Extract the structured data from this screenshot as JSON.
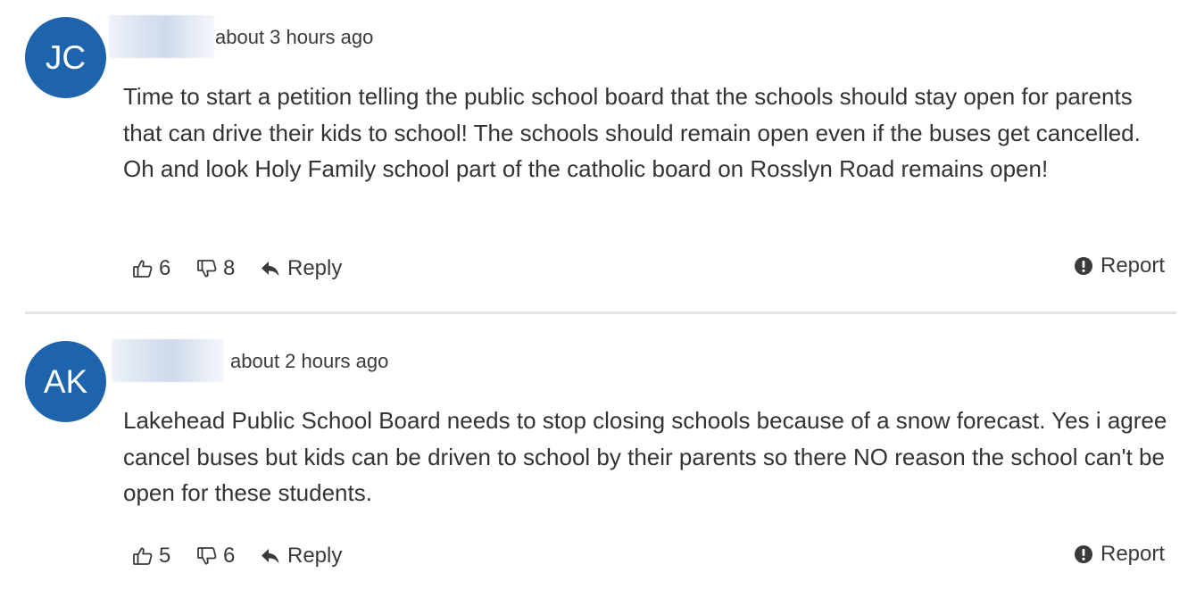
{
  "comments": [
    {
      "initials": "JC",
      "timestamp": "about 3 hours ago",
      "text": "Time to start a petition telling the public school board that the schools should stay open for parents that can drive their kids to school! The schools should remain open even if the buses get cancelled. Oh and look Holy Family school part of the catholic board on Rosslyn Road remains open!",
      "likes": "6",
      "dislikes": "8",
      "reply_label": "Reply",
      "report_label": "Report"
    },
    {
      "initials": "AK",
      "timestamp": "about 2 hours ago",
      "text": "Lakehead Public School Board needs to stop closing schools because of a snow forecast. Yes i agree cancel buses but kids can be driven to school by their parents so there NO reason the school can't be open for these students.",
      "likes": "5",
      "dislikes": "6",
      "reply_label": "Reply",
      "report_label": "Report"
    }
  ],
  "colors": {
    "avatar_bg": "#1d64ad",
    "text": "#333333",
    "divider": "#e5e5e5"
  },
  "icons": {
    "like": "thumbs-up-outline-icon",
    "dislike": "thumbs-down-outline-icon",
    "reply": "reply-arrow-icon",
    "report": "exclamation-circle-icon"
  }
}
